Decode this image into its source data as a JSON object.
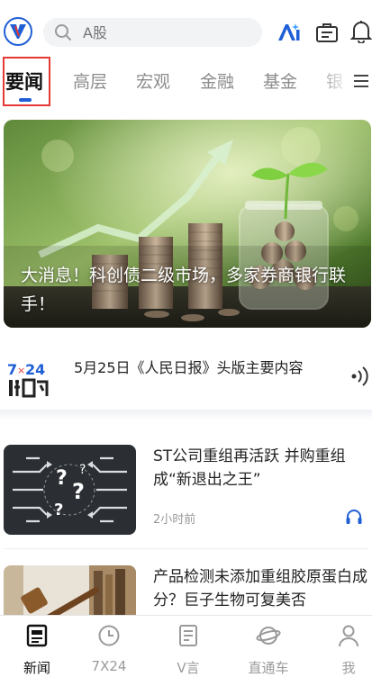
{
  "header": {
    "search_placeholder": "A股"
  },
  "tabs": [
    {
      "label": "要闻",
      "active": true
    },
    {
      "label": "高层"
    },
    {
      "label": "宏观"
    },
    {
      "label": "金融"
    },
    {
      "label": "基金"
    },
    {
      "label": "银"
    }
  ],
  "hero": {
    "title": "大消息！科创债二级市场，多家券商银行联手！"
  },
  "flash": {
    "text": "5月25日《人民日报》头版主要内容"
  },
  "news": [
    {
      "title": "ST公司重组再活跃 并购重组成“新退出之王”",
      "time": "2小时前"
    },
    {
      "title": "产品检测未添加重组胶原蛋白成分？巨子生物可复美否",
      "time": ""
    }
  ],
  "bottom_nav": [
    {
      "label": "新闻",
      "icon": "news-icon",
      "active": true
    },
    {
      "label": "7X24",
      "icon": "clock-icon"
    },
    {
      "label": "V言",
      "icon": "document-icon"
    },
    {
      "label": "直通车",
      "icon": "planet-icon"
    },
    {
      "label": "我",
      "icon": "person-icon"
    }
  ],
  "colors": {
    "accent": "#1f5fd6",
    "highlight_box": "#e53935"
  }
}
